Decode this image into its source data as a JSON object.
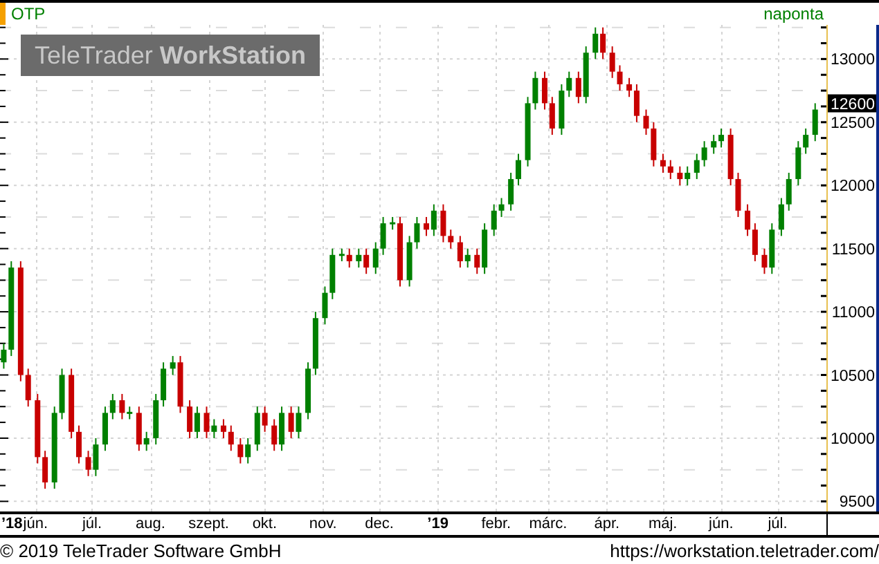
{
  "header": {
    "symbol": "OTP",
    "period": "naponta"
  },
  "logo": "TeleTrader **WorkStation**",
  "last_price": "12600",
  "chart_data": {
    "type": "candlestick",
    "grid": true,
    "xlim": [
      "2018-05-13",
      "2019-08-24"
    ],
    "ylim": [
      9420,
      13270
    ],
    "yticks": [
      9500,
      10000,
      10500,
      11000,
      11500,
      12000,
      12500,
      13000
    ],
    "x": [
      "2018-05-15",
      "2018-05-19",
      "2018-05-24",
      "2018-05-28",
      "2018-06-02",
      "2018-06-06",
      "2018-06-11",
      "2018-06-15",
      "2018-06-20",
      "2018-06-24",
      "2018-06-29",
      "2018-07-03",
      "2018-07-08",
      "2018-07-12",
      "2018-07-17",
      "2018-07-21",
      "2018-07-26",
      "2018-07-30",
      "2018-08-04",
      "2018-08-08",
      "2018-08-13",
      "2018-08-17",
      "2018-08-22",
      "2018-08-26",
      "2018-08-31",
      "2018-09-04",
      "2018-09-09",
      "2018-09-13",
      "2018-09-18",
      "2018-09-22",
      "2018-09-27",
      "2018-10-01",
      "2018-10-06",
      "2018-10-10",
      "2018-10-15",
      "2018-10-19",
      "2018-10-24",
      "2018-10-28",
      "2018-11-02",
      "2018-11-06",
      "2018-11-11",
      "2018-11-15",
      "2018-11-20",
      "2018-11-24",
      "2018-11-29",
      "2018-12-03",
      "2018-12-08",
      "2018-12-12",
      "2018-12-17",
      "2018-12-21",
      "2018-12-26",
      "2018-12-30",
      "2019-01-04",
      "2019-01-08",
      "2019-01-13",
      "2019-01-17",
      "2019-01-22",
      "2019-01-26",
      "2019-01-31",
      "2019-02-04",
      "2019-02-09",
      "2019-02-13",
      "2019-02-18",
      "2019-02-22",
      "2019-02-27",
      "2019-03-03",
      "2019-03-08",
      "2019-03-12",
      "2019-03-17",
      "2019-03-21",
      "2019-03-26",
      "2019-03-30",
      "2019-04-04",
      "2019-04-08",
      "2019-04-13",
      "2019-04-17",
      "2019-04-22",
      "2019-04-26",
      "2019-05-01",
      "2019-05-05",
      "2019-05-10",
      "2019-05-14",
      "2019-05-19",
      "2019-05-23",
      "2019-05-28",
      "2019-06-01",
      "2019-06-06",
      "2019-06-10",
      "2019-06-15",
      "2019-06-19",
      "2019-06-24",
      "2019-06-28",
      "2019-07-03",
      "2019-07-07",
      "2019-07-12",
      "2019-07-16",
      "2019-07-21"
    ],
    "xticks": [
      {
        "value": "2018-05-15",
        "label": "’18"
      },
      {
        "value": "2018-06-01",
        "label": "jún."
      },
      {
        "value": "2018-07-01",
        "label": "júl."
      },
      {
        "value": "2018-08-01",
        "label": "aug."
      },
      {
        "value": "2018-09-01",
        "label": "szept."
      },
      {
        "value": "2018-10-01",
        "label": "okt."
      },
      {
        "value": "2018-11-01",
        "label": "nov."
      },
      {
        "value": "2018-12-01",
        "label": "dec."
      },
      {
        "value": "2019-01-01",
        "label": "’19"
      },
      {
        "value": "2019-02-01",
        "label": "febr."
      },
      {
        "value": "2019-03-01",
        "label": "márc."
      },
      {
        "value": "2019-04-01",
        "label": "ápr."
      },
      {
        "value": "2019-05-01",
        "label": "máj."
      },
      {
        "value": "2019-06-01",
        "label": "jún."
      },
      {
        "value": "2019-07-01",
        "label": "júl."
      }
    ],
    "ohlc": [
      [
        10600,
        10750,
        10550,
        10700
      ],
      [
        10700,
        11400,
        10650,
        11350
      ],
      [
        11350,
        11400,
        10450,
        10500
      ],
      [
        10500,
        10550,
        10250,
        10300
      ],
      [
        10300,
        10350,
        9800,
        9850
      ],
      [
        9850,
        9900,
        9600,
        9650
      ],
      [
        9650,
        10250,
        9600,
        10200
      ],
      [
        10200,
        10550,
        10150,
        10500
      ],
      [
        10500,
        10550,
        10000,
        10050
      ],
      [
        10050,
        10100,
        9800,
        9850
      ],
      [
        9850,
        9900,
        9700,
        9750
      ],
      [
        9750,
        10000,
        9700,
        9950
      ],
      [
        9950,
        10250,
        9900,
        10200
      ],
      [
        10200,
        10350,
        10150,
        10300
      ],
      [
        10300,
        10350,
        10150,
        10200
      ],
      [
        10200,
        10250,
        10150,
        10200
      ],
      [
        10200,
        10250,
        9900,
        9950
      ],
      [
        9950,
        10050,
        9900,
        10000
      ],
      [
        10000,
        10350,
        9950,
        10300
      ],
      [
        10300,
        10600,
        10250,
        10550
      ],
      [
        10550,
        10650,
        10500,
        10600
      ],
      [
        10600,
        10650,
        10200,
        10250
      ],
      [
        10250,
        10300,
        10000,
        10050
      ],
      [
        10050,
        10250,
        10000,
        10200
      ],
      [
        10200,
        10250,
        10000,
        10050
      ],
      [
        10050,
        10150,
        10000,
        10100
      ],
      [
        10100,
        10150,
        10000,
        10050
      ],
      [
        10050,
        10100,
        9900,
        9950
      ],
      [
        9950,
        10000,
        9800,
        9850
      ],
      [
        9850,
        10000,
        9800,
        9950
      ],
      [
        9950,
        10250,
        9900,
        10200
      ],
      [
        10200,
        10250,
        10050,
        10100
      ],
      [
        10100,
        10150,
        9900,
        9950
      ],
      [
        9950,
        10250,
        9900,
        10200
      ],
      [
        10200,
        10250,
        10000,
        10050
      ],
      [
        10050,
        10250,
        10000,
        10200
      ],
      [
        10200,
        10600,
        10150,
        10550
      ],
      [
        10550,
        11000,
        10500,
        10950
      ],
      [
        10950,
        11200,
        10900,
        11150
      ],
      [
        11150,
        11500,
        11100,
        11450
      ],
      [
        11450,
        11500,
        11400,
        11450
      ],
      [
        11450,
        11500,
        11350,
        11400
      ],
      [
        11400,
        11500,
        11350,
        11450
      ],
      [
        11450,
        11500,
        11300,
        11350
      ],
      [
        11350,
        11550,
        11300,
        11500
      ],
      [
        11500,
        11750,
        11450,
        11700
      ],
      [
        11700,
        11750,
        11650,
        11700
      ],
      [
        11700,
        11750,
        11200,
        11250
      ],
      [
        11250,
        11600,
        11200,
        11550
      ],
      [
        11550,
        11750,
        11500,
        11700
      ],
      [
        11700,
        11750,
        11600,
        11650
      ],
      [
        11650,
        11850,
        11600,
        11800
      ],
      [
        11800,
        11850,
        11550,
        11600
      ],
      [
        11600,
        11650,
        11500,
        11550
      ],
      [
        11550,
        11600,
        11350,
        11400
      ],
      [
        11400,
        11500,
        11350,
        11450
      ],
      [
        11450,
        11500,
        11300,
        11350
      ],
      [
        11350,
        11700,
        11300,
        11650
      ],
      [
        11650,
        11850,
        11600,
        11800
      ],
      [
        11800,
        11900,
        11750,
        11850
      ],
      [
        11850,
        12100,
        11800,
        12050
      ],
      [
        12050,
        12250,
        12000,
        12200
      ],
      [
        12200,
        12700,
        12150,
        12650
      ],
      [
        12650,
        12900,
        12600,
        12850
      ],
      [
        12850,
        12900,
        12600,
        12650
      ],
      [
        12650,
        12700,
        12400,
        12450
      ],
      [
        12450,
        12800,
        12400,
        12750
      ],
      [
        12750,
        12900,
        12700,
        12850
      ],
      [
        12850,
        12900,
        12650,
        12700
      ],
      [
        12700,
        13100,
        12650,
        13050
      ],
      [
        13050,
        13250,
        13000,
        13200
      ],
      [
        13200,
        13250,
        13000,
        13050
      ],
      [
        13050,
        13100,
        12850,
        12900
      ],
      [
        12900,
        12950,
        12750,
        12800
      ],
      [
        12800,
        12850,
        12700,
        12750
      ],
      [
        12750,
        12800,
        12500,
        12550
      ],
      [
        12550,
        12600,
        12400,
        12450
      ],
      [
        12450,
        12500,
        12150,
        12200
      ],
      [
        12200,
        12250,
        12100,
        12150
      ],
      [
        12150,
        12200,
        12050,
        12100
      ],
      [
        12100,
        12150,
        12000,
        12050
      ],
      [
        12050,
        12150,
        12000,
        12100
      ],
      [
        12100,
        12250,
        12050,
        12200
      ],
      [
        12200,
        12350,
        12150,
        12300
      ],
      [
        12300,
        12400,
        12250,
        12350
      ],
      [
        12350,
        12450,
        12300,
        12400
      ],
      [
        12400,
        12450,
        12000,
        12050
      ],
      [
        12050,
        12100,
        11750,
        11800
      ],
      [
        11800,
        11850,
        11600,
        11650
      ],
      [
        11650,
        11700,
        11400,
        11450
      ],
      [
        11450,
        11500,
        11300,
        11350
      ],
      [
        11350,
        11700,
        11300,
        11650
      ],
      [
        11650,
        11900,
        11600,
        11850
      ],
      [
        11850,
        12100,
        11800,
        12050
      ],
      [
        12050,
        12350,
        12000,
        12300
      ],
      [
        12300,
        12450,
        12250,
        12400
      ],
      [
        12400,
        12650,
        12350,
        12600
      ]
    ]
  },
  "footer": {
    "copyright": "© 2019 TeleTrader Software GmbH",
    "url": "https://workstation.teletrader.com/"
  }
}
